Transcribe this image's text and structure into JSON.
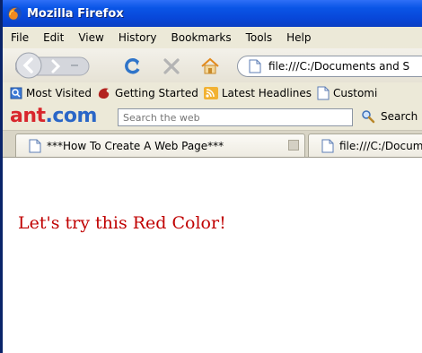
{
  "window": {
    "title": "Mozilla Firefox"
  },
  "menu": [
    {
      "label": "File"
    },
    {
      "label": "Edit"
    },
    {
      "label": "View"
    },
    {
      "label": "History"
    },
    {
      "label": "Bookmarks"
    },
    {
      "label": "Tools"
    },
    {
      "label": "Help"
    }
  ],
  "navigation": {
    "url": "file:///C:/Documents and S"
  },
  "bookmarks": [
    {
      "label": "Most Visited",
      "icon": "most-visited-icon"
    },
    {
      "label": "Getting Started",
      "icon": "firefox-icon"
    },
    {
      "label": "Latest Headlines",
      "icon": "rss-feed-icon"
    },
    {
      "label": "Customi",
      "icon": "page-icon"
    }
  ],
  "ant_toolbar": {
    "logo_main": "ant",
    "logo_suffix": ".com",
    "search_placeholder": "Search the web",
    "search_button": "Search"
  },
  "tabs": [
    {
      "label": "***How To Create A Web Page***",
      "active": true
    },
    {
      "label": "file:///C:/Docum",
      "active": false
    }
  ],
  "page": {
    "heading": "Let's try this Red Color!",
    "heading_color": "#c00000"
  },
  "colors": {
    "titlebar": "#0a55e6",
    "chrome": "#ece9d8",
    "logo_red": "#d8262c",
    "logo_blue": "#2a66c7"
  }
}
